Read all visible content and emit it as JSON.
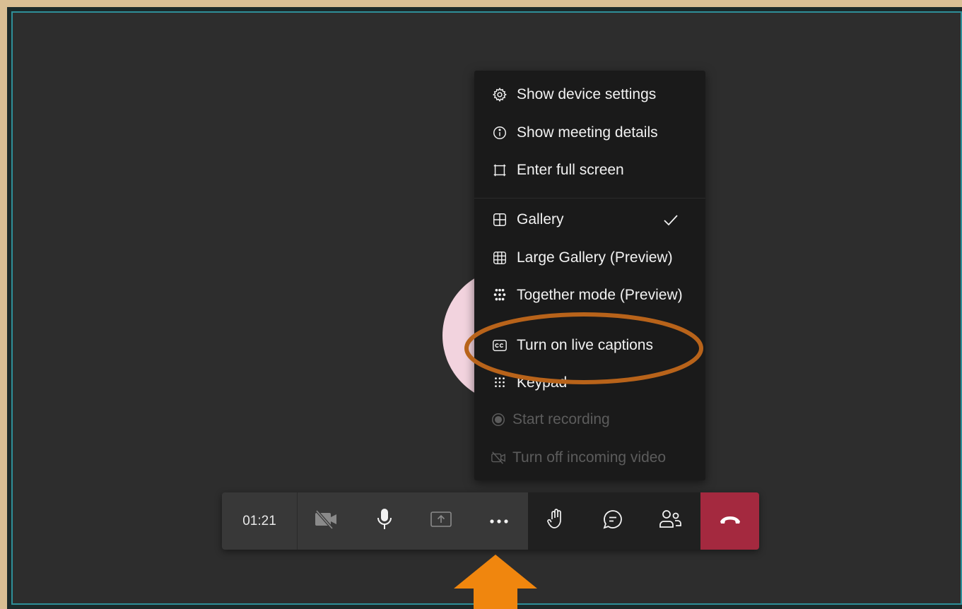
{
  "menu": {
    "items": [
      {
        "label": "Show device settings",
        "icon": "gear-icon"
      },
      {
        "label": "Show meeting details",
        "icon": "info-icon"
      },
      {
        "label": "Enter full screen",
        "icon": "fullscreen-icon"
      },
      {
        "label": "Gallery",
        "icon": "gallery-icon",
        "checked": true
      },
      {
        "label": "Large Gallery (Preview)",
        "icon": "large-gallery-icon"
      },
      {
        "label": "Together mode (Preview)",
        "icon": "together-mode-icon"
      },
      {
        "label": "Turn on live captions",
        "icon": "closed-captions-icon"
      },
      {
        "label": "Keypad",
        "icon": "keypad-icon"
      },
      {
        "label": "Start recording",
        "icon": "record-icon",
        "disabled": true
      },
      {
        "label": "Turn off incoming video",
        "icon": "video-off-icon",
        "disabled": true
      }
    ]
  },
  "toolbar": {
    "timer": "01:21",
    "buttons": [
      "camera-off-icon",
      "microphone-icon",
      "share-screen-icon",
      "more-actions-icon",
      "raise-hand-icon",
      "chat-icon",
      "participants-icon",
      "hang-up-icon"
    ]
  },
  "colors": {
    "page_border": "#d9bf94",
    "screen_border": "#2f8f99",
    "meeting_bg": "#2d2d2d",
    "menu_bg": "#1a1a1a",
    "hangup": "#a4293f",
    "highlight_oval": "#b8631a",
    "arrow": "#f0860e"
  }
}
